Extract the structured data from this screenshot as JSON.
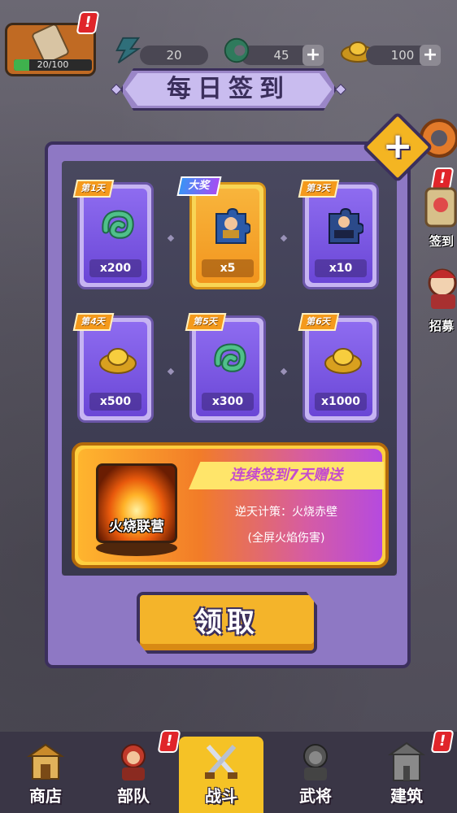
{
  "top_bar": {
    "level_progress": "20/100",
    "level_progress_fraction": 0.2,
    "stamina": "20",
    "jade": "45",
    "gold": "100"
  },
  "title": "每日签到",
  "cards": [
    {
      "day_tag": "第1天",
      "amount": "x200",
      "icon": "jade-dragon-icon",
      "style": "normal"
    },
    {
      "day_tag": "大奖",
      "amount": "x5",
      "icon": "puzzle-piece-hero-icon",
      "style": "gold"
    },
    {
      "day_tag": "第3天",
      "amount": "x10",
      "icon": "puzzle-piece-blue-icon",
      "style": "normal"
    },
    {
      "day_tag": "第4天",
      "amount": "x500",
      "icon": "gold-ingot-icon",
      "style": "normal"
    },
    {
      "day_tag": "第5天",
      "amount": "x300",
      "icon": "jade-dragon-icon",
      "style": "normal"
    },
    {
      "day_tag": "第6天",
      "amount": "x1000",
      "icon": "gold-ingot-icon",
      "style": "normal"
    }
  ],
  "bonus": {
    "title": "连续签到7天赠送",
    "skill_name": "火烧联营",
    "line1": "逆天计策：火烧赤壁",
    "line2": "(全屏火焰伤害)"
  },
  "claim_button": "领取",
  "side_buttons": {
    "signin": "签到",
    "recruit": "招募"
  },
  "bottom_nav": [
    {
      "label": "商店",
      "icon": "shop-icon"
    },
    {
      "label": "部队",
      "icon": "troops-icon"
    },
    {
      "label": "战斗",
      "icon": "battle-swords-icon"
    },
    {
      "label": "武将",
      "icon": "general-icon"
    },
    {
      "label": "建筑",
      "icon": "building-icon"
    }
  ],
  "colors": {
    "panel": "#8e78c4",
    "panel_border": "#3b2f5c",
    "gold_button": "#f4b42a",
    "alert": "#e0252a"
  }
}
